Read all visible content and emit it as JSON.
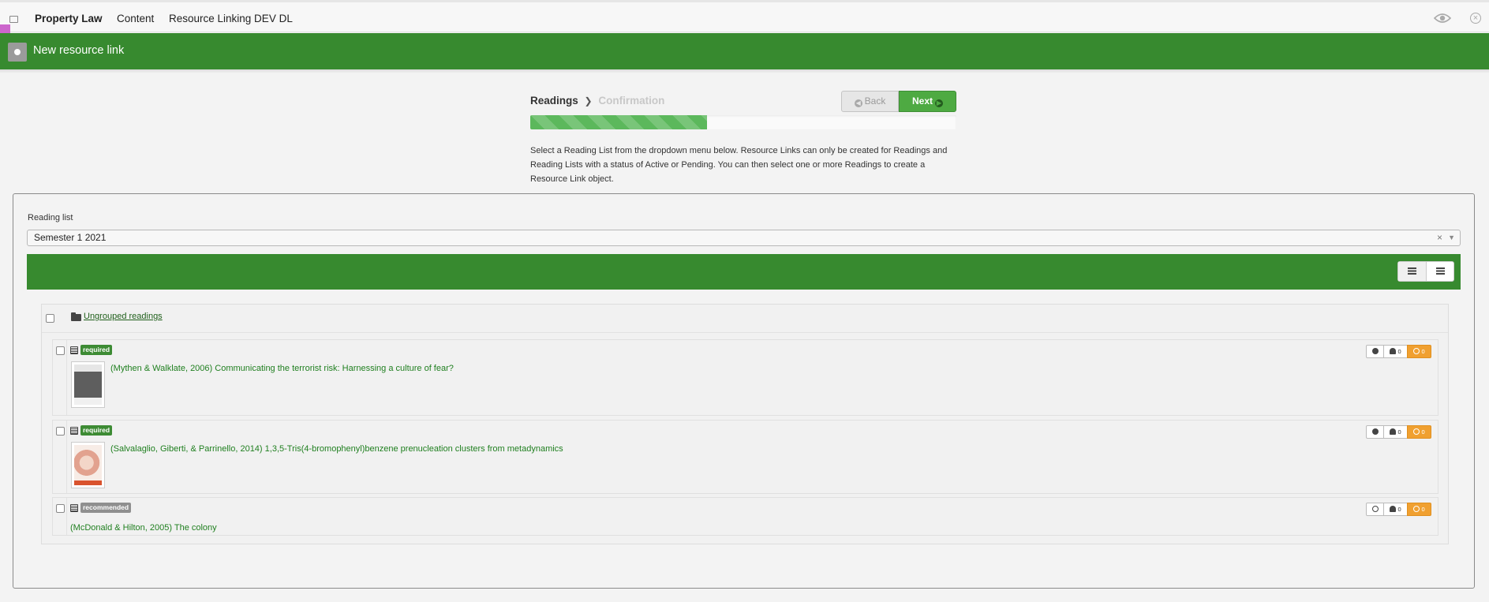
{
  "topbar": {
    "course": "Property Law",
    "nav": [
      "Content",
      "Resource Linking DEV DL"
    ]
  },
  "header": {
    "title": "New resource link"
  },
  "wizard": {
    "steps": [
      "Readings",
      "Confirmation"
    ],
    "back_label": "Back",
    "next_label": "Next",
    "progress_fraction": 0.415,
    "intro": "Select a Reading List from the dropdown menu below. Resource Links can only be created for Readings and Reading Lists with a status of Active or Pending. You can then select one or more Readings to create a Resource Link object."
  },
  "reading_list": {
    "label": "Reading list",
    "selected": "Semester 1 2021",
    "clear_symbol": "×"
  },
  "group": {
    "title": "Ungrouped readings",
    "items": [
      {
        "badge": "required",
        "title": "(Mythen & Walklate, 2006) Communicating the terrorist risk: Harnessing a culture of fear?",
        "user_count": "0",
        "warn_count": "0"
      },
      {
        "badge": "required",
        "title": "(Salvalaglio, Giberti, & Parrinello, 2014) 1,3,5-Tris(4-bromophenyl)benzene prenucleation clusters from metadynamics",
        "user_count": "0",
        "warn_count": "0"
      },
      {
        "badge": "recommended",
        "title": "(McDonald & Hilton, 2005) The colony",
        "user_count": "0",
        "warn_count": "0"
      }
    ]
  },
  "colors": {
    "brand_green": "#378a2f",
    "required_badge": "#3d8b34",
    "recommended_badge": "#8f8f8f",
    "warning": "#f0a030"
  }
}
